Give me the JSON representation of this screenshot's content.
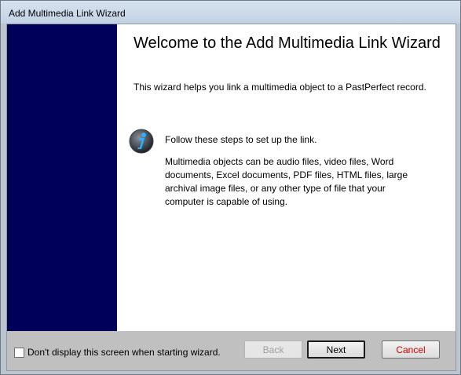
{
  "window": {
    "title": "Add Multimedia Link Wizard"
  },
  "content": {
    "heading": "Welcome to the Add Multimedia Link Wizard",
    "intro": "This wizard helps you link a multimedia object to a PastPerfect record.",
    "steps": "Follow these steps to set up the link.",
    "details": "Multimedia objects can be audio files, video files, Word documents, Excel documents, PDF files, HTML files, large archival image files, or any other type of file that your computer is capable of using."
  },
  "footer": {
    "checkbox_label": "Don't display this screen when starting wizard.",
    "checkbox_checked": false,
    "back_label": "Back",
    "next_label": "Next",
    "cancel_label": "Cancel"
  },
  "colors": {
    "sidebar": "#00005a",
    "footer": "#c0c0c0",
    "cancel_text": "#d00000"
  },
  "icons": {
    "info": "info-icon"
  }
}
